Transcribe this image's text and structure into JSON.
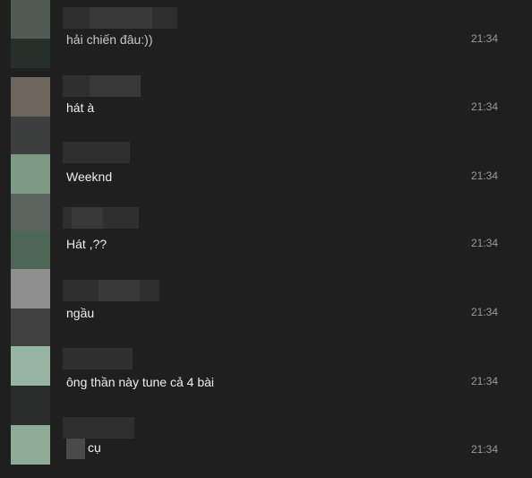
{
  "messages": [
    {
      "text": "hải chiến đâu:))",
      "time": "21:34"
    },
    {
      "text": "hát à",
      "time": "21:34"
    },
    {
      "text": "Weeknd",
      "time": "21:34"
    },
    {
      "text": "Hát ,??",
      "time": "21:34"
    },
    {
      "text": "ngầu",
      "time": "21:34"
    },
    {
      "text": "ông thần này tune cả 4 bài",
      "time": "21:34"
    },
    {
      "text": "cụ",
      "time": "21:34"
    }
  ],
  "colors": {
    "background": "#1f1f1f",
    "message_text": "#eeeeee",
    "timestamp": "#9a9a9a",
    "redacted_block": "#2f2f2f"
  },
  "icons": {
    "avatar": "blurred-avatar",
    "username": "blurred-username",
    "mention": "blurred-mention"
  }
}
